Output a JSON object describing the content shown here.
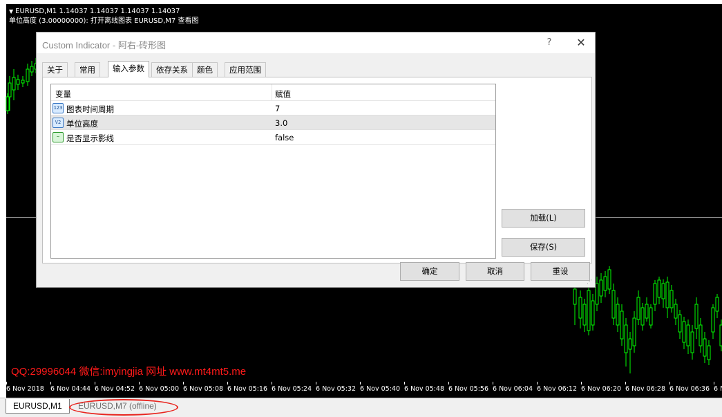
{
  "chart": {
    "header": "EURUSD,M1  1.14037 1.14037 1.14037 1.14037",
    "indicator_line": "单位高度 (3.00000000): 打开离线图表 EURUSD,M7 查看图",
    "watermark": "QQ:29996044 微信:imyingjia 网址 www.mt4mt5.me",
    "time_axis": [
      "6 Nov 2018",
      "6 Nov 04:44",
      "6 Nov 04:52",
      "6 Nov 05:00",
      "6 Nov 05:08",
      "6 Nov 05:16",
      "6 Nov 05:24",
      "6 Nov 05:32",
      "6 Nov 05:40",
      "6 Nov 05:48",
      "6 Nov 05:56",
      "6 Nov 06:04",
      "6 Nov 06:12",
      "6 Nov 06:20",
      "6 Nov 06:28",
      "6 Nov 06:36",
      "6 N"
    ],
    "colors": {
      "background": "#000000",
      "up_candle": "#00ff00",
      "text": "#ffffff",
      "watermark": "#ff1a1a"
    }
  },
  "chart_tabs": [
    {
      "label": "EURUSD,M1"
    },
    {
      "label": "EURUSD,M7 (offline)"
    }
  ],
  "dialog": {
    "title": "Custom Indicator - 阿右-砖形图",
    "help_label": "?",
    "close_label": "✕",
    "tabs": [
      {
        "label": "关于"
      },
      {
        "label": "常用"
      },
      {
        "label": "输入参数",
        "active": true
      },
      {
        "label": "依存关系"
      },
      {
        "label": "颜色"
      },
      {
        "label": "应用范围"
      }
    ],
    "table": {
      "headers": {
        "variable": "变量",
        "value": "赋值"
      },
      "rows": [
        {
          "icon": "integer-param-icon",
          "icon_text": "123",
          "name": "图表时间周期",
          "value": "7"
        },
        {
          "icon": "double-param-icon",
          "icon_text": "V2",
          "name": "单位高度",
          "value": "3.0",
          "selected": true
        },
        {
          "icon": "bool-param-icon",
          "icon_text": "~",
          "name": "是否显示影线",
          "value": "false"
        }
      ]
    },
    "buttons": {
      "load": "加载(L)",
      "save": "保存(S)",
      "ok": "确定",
      "cancel": "取消",
      "reset": "重设"
    }
  }
}
